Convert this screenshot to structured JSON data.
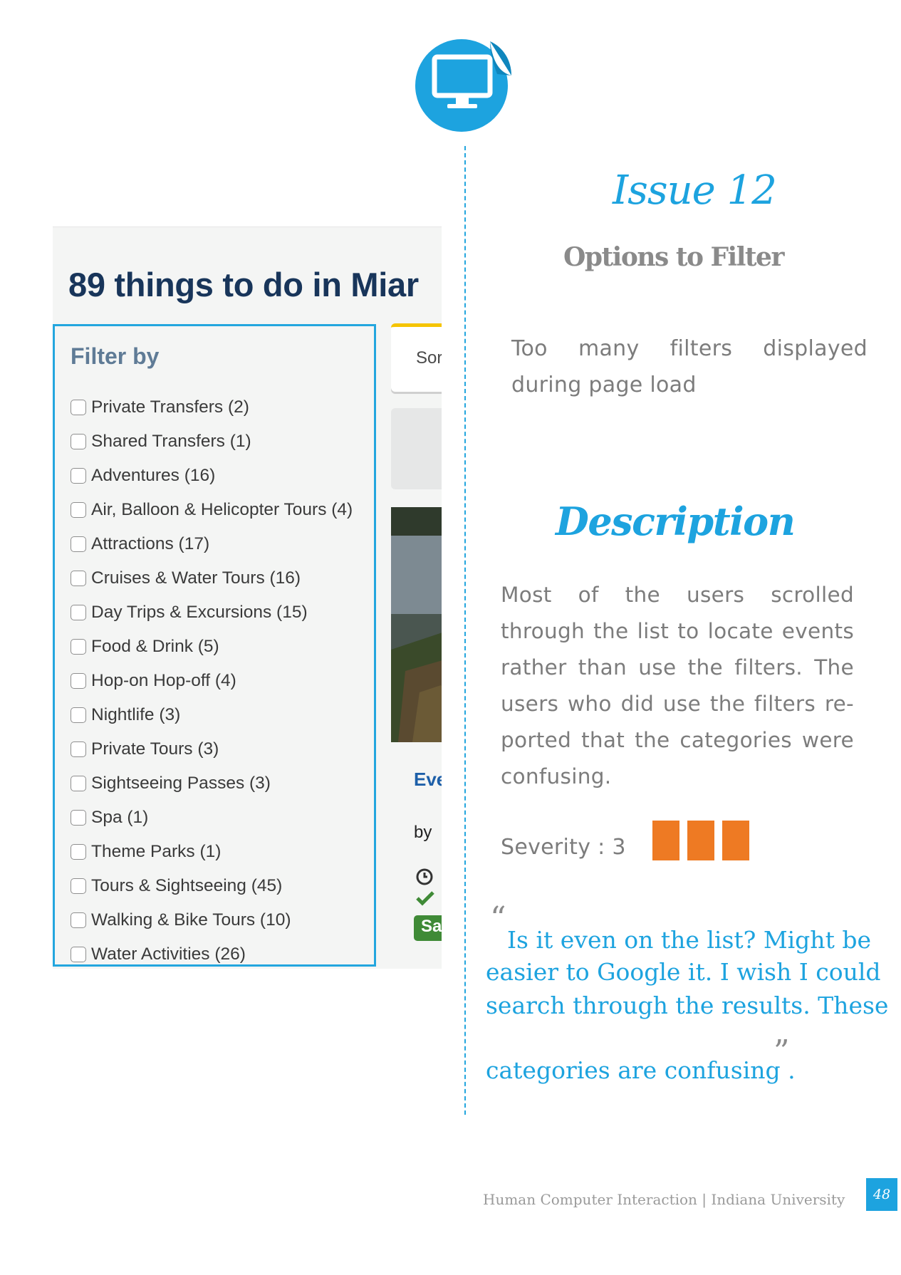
{
  "screenshot": {
    "title": "89 things to do in Miar",
    "filter_heading": "Filter by",
    "filters": [
      "Private Transfers (2)",
      "Shared Transfers (1)",
      "Adventures (16)",
      "Air, Balloon & Helicopter Tours (4)",
      "Attractions (17)",
      "Cruises & Water Tours (16)",
      "Day Trips & Excursions (15)",
      "Food & Drink (5)",
      "Hop-on Hop-off (4)",
      "Nightlife (3)",
      "Private Tours (3)",
      "Sightseeing Passes (3)",
      "Spa (1)",
      "Theme Parks (1)",
      "Tours & Sightseeing (45)",
      "Walking & Bike Tours (10)",
      "Water Activities (26)"
    ],
    "sort_label": "Sor",
    "card_link": "Eve",
    "card_by": "by",
    "sale_label": "Sa"
  },
  "issue": {
    "title": "Issue 12",
    "subtitle": "Options to Filter",
    "text": "Too many filters displayed during page load"
  },
  "description": {
    "title": "Description",
    "text": "Most of the users scrolled through the list to locate events rather than use the filters. The users who did use the filters re-ported that the categories were confusing."
  },
  "severity": {
    "label": "Severity : 3",
    "level": 3,
    "color": "#ee7a23"
  },
  "quote": {
    "open_mark": "“",
    "close_mark": "”",
    "lines": [
      "Is it even on the list? Might be",
      "easier to Google it. I wish I could",
      "search through the results. These",
      "categories are confusing ."
    ]
  },
  "footer": {
    "text": "Human Computer Interaction | Indiana University",
    "page_number": "48"
  },
  "colors": {
    "accent": "#1da3df",
    "text_grey": "#7c7c7c"
  }
}
